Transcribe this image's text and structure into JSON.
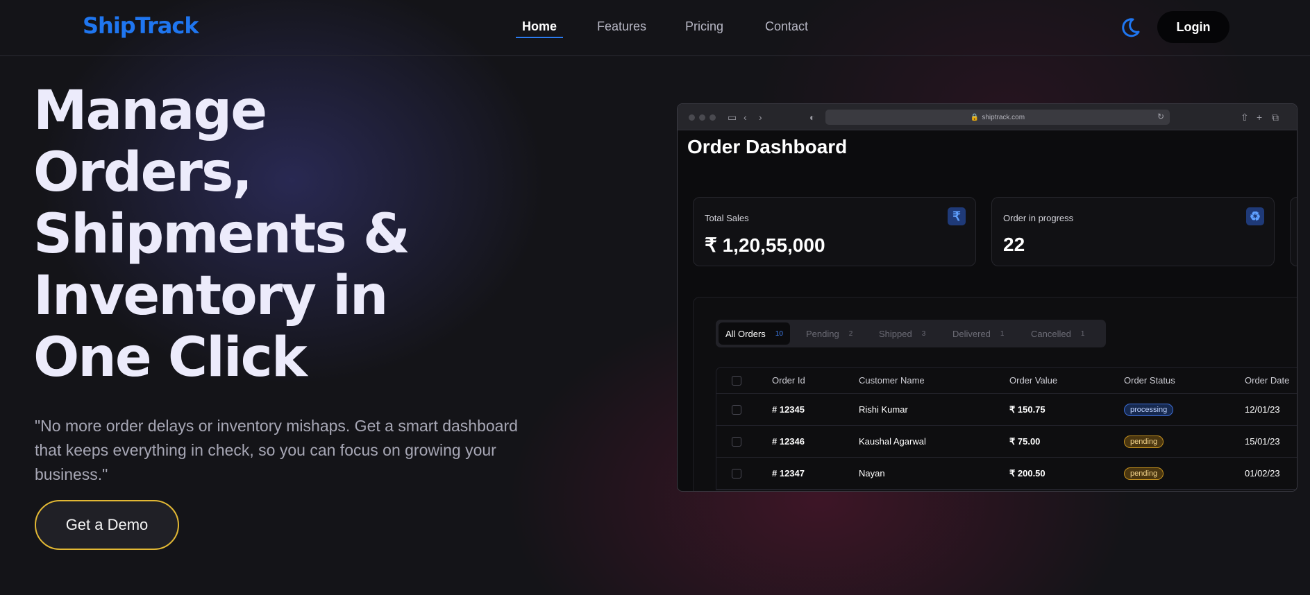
{
  "nav": {
    "logo": "ShipTrack",
    "links": [
      "Home",
      "Features",
      "Pricing",
      "Contact"
    ],
    "active": "Home",
    "login_label": "Login",
    "theme_icon": "moon-icon"
  },
  "hero": {
    "title_lines": [
      "Manage",
      "Orders,",
      "Shipments &",
      "Inventory in",
      "One Click"
    ],
    "subtitle": "\"No more order delays or inventory mishaps. Get a smart dashboard that keeps everything in check, so you can focus on growing your business.\"",
    "cta_label": "Get a Demo"
  },
  "browser": {
    "url": "shiptrack.com",
    "dashboard": {
      "title": "Order Dashboard",
      "cards": [
        {
          "label": "Total Sales",
          "value": "₹ 1,20,55,000",
          "icon": "rupee-icon"
        },
        {
          "label": "Order in progress",
          "value": "22",
          "icon": "recycle-icon"
        }
      ],
      "tabs": [
        {
          "label": "All Orders",
          "count": "10"
        },
        {
          "label": "Pending",
          "count": "2"
        },
        {
          "label": "Shipped",
          "count": "3"
        },
        {
          "label": "Delivered",
          "count": "1"
        },
        {
          "label": "Cancelled",
          "count": "1"
        }
      ],
      "columns": [
        "Order Id",
        "Customer Name",
        "Order Value",
        "Order Status",
        "Order Date"
      ],
      "rows": [
        {
          "id": "# 12345",
          "customer": "Rishi Kumar",
          "value": "₹ 150.75",
          "status": "processing",
          "date": "12/01/23"
        },
        {
          "id": "# 12346",
          "customer": "Kaushal Agarwal",
          "value": "₹ 75.00",
          "status": "pending",
          "date": "15/01/23"
        },
        {
          "id": "# 12347",
          "customer": "Nayan",
          "value": "₹ 200.50",
          "status": "pending",
          "date": "01/02/23"
        }
      ]
    }
  },
  "colors": {
    "brand": "#1f76f0",
    "cta_border": "#e2b834",
    "processing": "#3e6ed6",
    "pending": "#c3901e"
  }
}
